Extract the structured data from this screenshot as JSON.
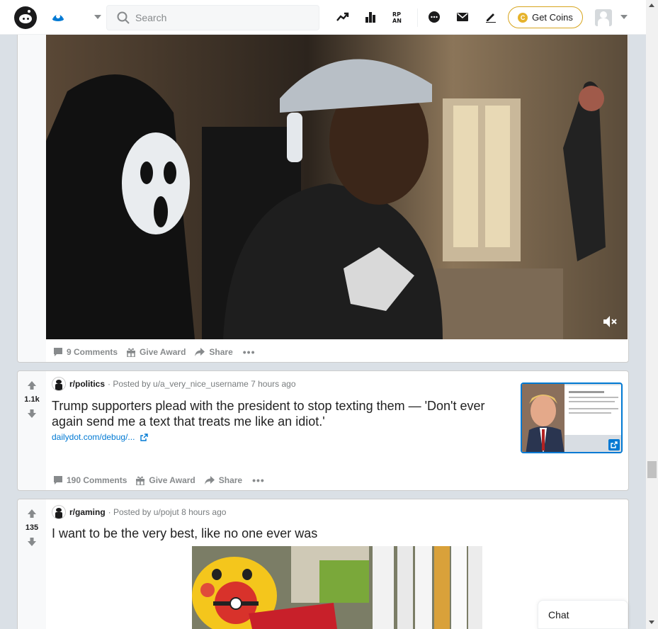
{
  "header": {
    "search_placeholder": "Search",
    "coins_label": "Get Coins",
    "coin_symbol": "C",
    "icons": [
      "reddit-logo-icon",
      "home-feed-icon",
      "trending-icon",
      "leaderboard-icon",
      "rpan-icon",
      "chat-icon",
      "mail-icon",
      "create-post-icon",
      "avatar-icon"
    ],
    "accent_color": "#0079d3",
    "coin_color": "#d7a51e"
  },
  "posts": [
    {
      "comments": "9 Comments",
      "award": "Give Award",
      "share": "Share",
      "media": "video"
    },
    {
      "score": "1.1k",
      "subreddit": "r/politics",
      "posted_by": "· Posted by u/a_very_nice_username 7 hours ago",
      "title_line1": "Trump supporters plead with the president to stop texting them — 'Don't ever",
      "title_line2": "again send me a text that treats me like an idiot.'",
      "link": "dailydot.com/debug/...",
      "comments": "190 Comments",
      "award": "Give Award",
      "share": "Share"
    },
    {
      "score": "135",
      "subreddit": "r/gaming",
      "posted_by": "· Posted by u/pojut 8 hours ago",
      "title": "I want to be the very best, like no one ever was"
    }
  ],
  "chat": {
    "label": "Chat"
  }
}
